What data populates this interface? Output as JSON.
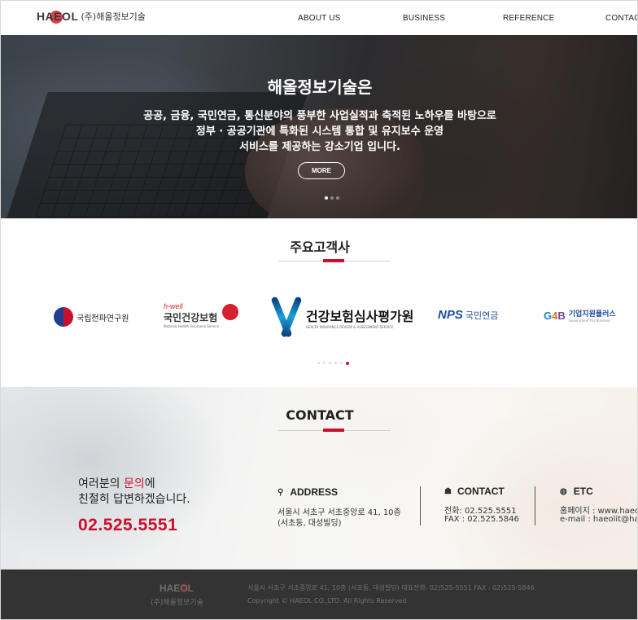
{
  "header": {
    "logo_mark": "HAEOL",
    "company_name": "(주)해올정보기술",
    "nav": [
      "ABOUT US",
      "BUSINESS",
      "REFERENCE",
      "CONTACT"
    ]
  },
  "hero": {
    "title": "해올정보기술은",
    "lines": [
      "공공, 금융, 국민연금, 통신분야의 풍부한 사업실적과 축적된 노하우를 바탕으로",
      "정부 · 공공기관에 특화된 시스템 통합 및 유지보수 운영",
      "서비스를 제공하는 강소기업 입니다."
    ],
    "more_label": "MORE",
    "slide_count": 3,
    "active_slide": 1
  },
  "clients": {
    "title": "주요고객사",
    "logos": [
      {
        "name": "국립전파연구원",
        "icon": "taegeuk-emblem-icon"
      },
      {
        "name_small": "h-well",
        "name": "국민건강보험",
        "sub": "National Health Insurance Service",
        "icon": "heart-icon"
      },
      {
        "name": "건강보험심사평가원",
        "sub": "HEALTH INSURANCE REVIEW & ASSESSMENT SERVICE",
        "icon": "hira-x-icon"
      },
      {
        "mark": "NPS",
        "name": "국민연금"
      },
      {
        "mark_g": "G",
        "mark_4": "4",
        "mark_b": "B",
        "name": "기업지원플러스",
        "sub": "Government For Business"
      }
    ],
    "page_count": 6,
    "active_page": 6
  },
  "contact": {
    "title": "CONTACT",
    "ask_line1_before": "여러분의 ",
    "ask_line1_highlight": "문의",
    "ask_line1_after": "에",
    "ask_line2": "친절히 답변하겠습니다.",
    "phone_big": "02.525.5551",
    "address": {
      "heading": "ADDRESS",
      "icon": "location-pin-icon",
      "line1": "서울시 서초구 서초중앙로 41, 10층",
      "line2": "(서초동, 대성빌딩)"
    },
    "contact_info": {
      "heading": "CONTACT",
      "icon": "people-icon",
      "line1": "전화: 02.525.5551",
      "line2": "FAX : 02.525.5846"
    },
    "etc": {
      "heading": "ETC",
      "icon": "globe-icon",
      "line1": "홈페이지 : www.haeol.co.kr",
      "line2": "e-mail : haeolit@haeol.co.kr"
    }
  },
  "footer": {
    "logo_mark": "HAEOL",
    "company_name": "(주)해올정보기술",
    "address_line": "서울시 서초구 서초중앙로 41, 10층 (서초동, 대성빌딩) 대표전화: 02)525-5551 FAX : 02)525-5846",
    "copyright": "Copyright © HAEOL CO.,LTD. All Rights Reserved"
  },
  "colors": {
    "accent": "#c8102e",
    "footer_bg": "#333333"
  }
}
